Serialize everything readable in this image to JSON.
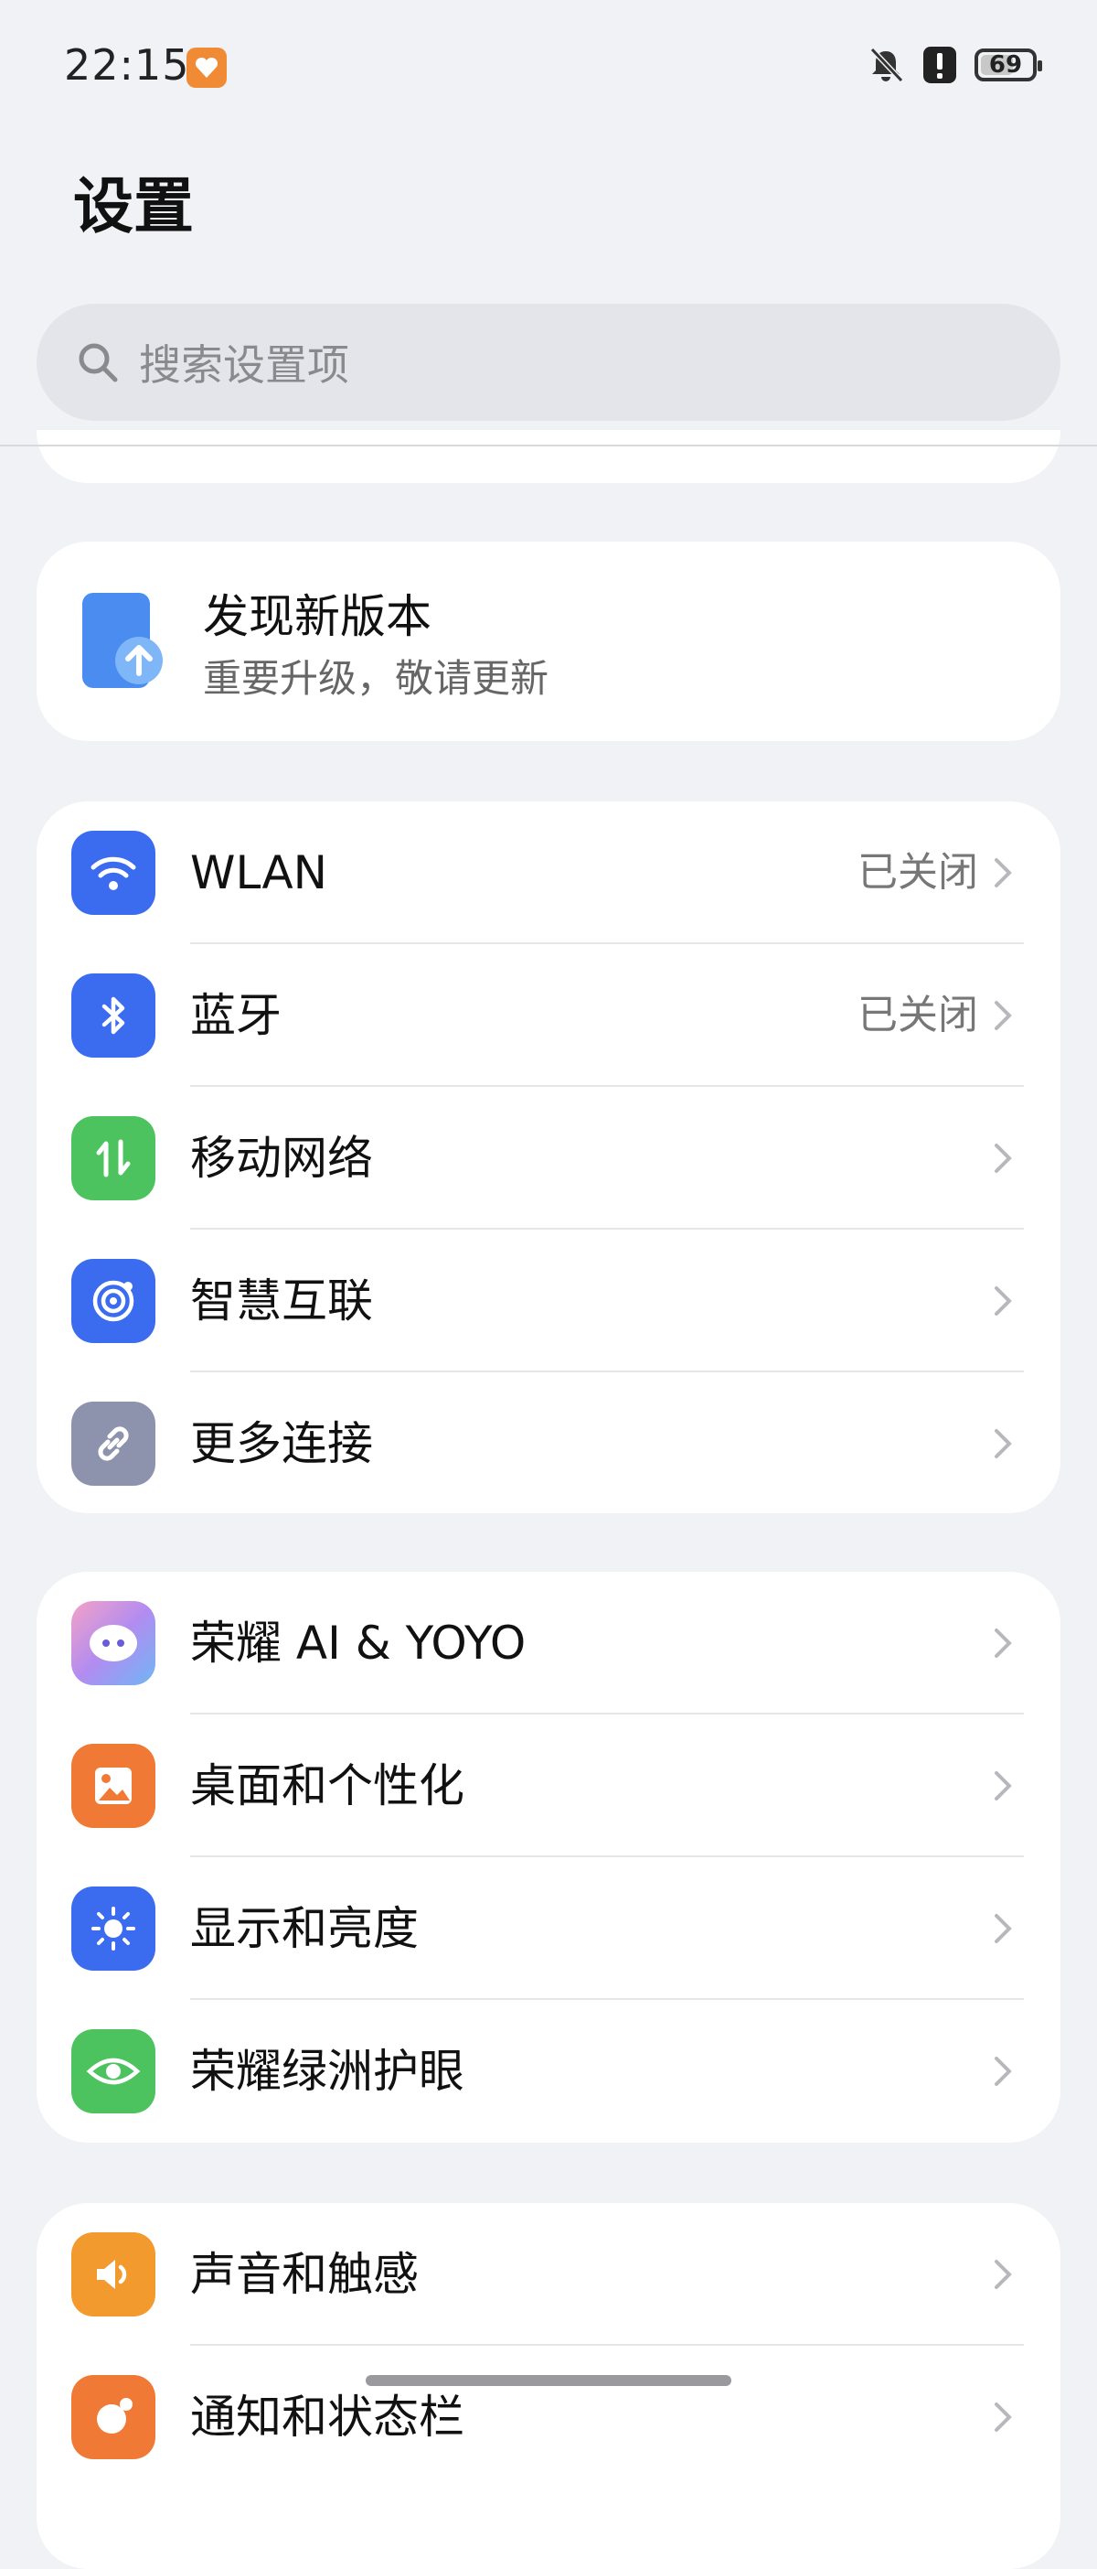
{
  "status_bar": {
    "time": "22:15",
    "battery": "69",
    "battery_level": 0.69
  },
  "page": {
    "title": "设置"
  },
  "search": {
    "placeholder": "搜索设置项"
  },
  "update_card": {
    "title": "发现新版本",
    "subtitle": "重要升级，敬请更新"
  },
  "groups": [
    {
      "items": [
        {
          "label": "WLAN",
          "value": "已关闭",
          "icon": "wifi-icon",
          "color": "#3b6cf0"
        },
        {
          "label": "蓝牙",
          "value": "已关闭",
          "icon": "bluetooth-icon",
          "color": "#3b6cf0"
        },
        {
          "label": "移动网络",
          "value": "",
          "icon": "mobile-data-icon",
          "color": "#4cc35e"
        },
        {
          "label": "智慧互联",
          "value": "",
          "icon": "smart-connect-icon",
          "color": "#3b6cf0"
        },
        {
          "label": "更多连接",
          "value": "",
          "icon": "link-icon",
          "color": "#8e93ad"
        }
      ]
    },
    {
      "items": [
        {
          "label": "荣耀 AI & YOYO",
          "icon": "yoyo-assistant-icon",
          "color": "#e889c8"
        },
        {
          "label": "桌面和个性化",
          "icon": "wallpaper-icon",
          "color": "#f07a35"
        },
        {
          "label": "显示和亮度",
          "icon": "brightness-icon",
          "color": "#3b6cf0"
        },
        {
          "label": "荣耀绿洲护眼",
          "icon": "eye-comfort-icon",
          "color": "#4cc35e"
        }
      ]
    },
    {
      "items": [
        {
          "label": "声音和触感",
          "icon": "sound-icon",
          "color": "#f39a2e"
        },
        {
          "label": "通知和状态栏",
          "icon": "notification-icon",
          "color": "#f07a35"
        }
      ]
    }
  ]
}
